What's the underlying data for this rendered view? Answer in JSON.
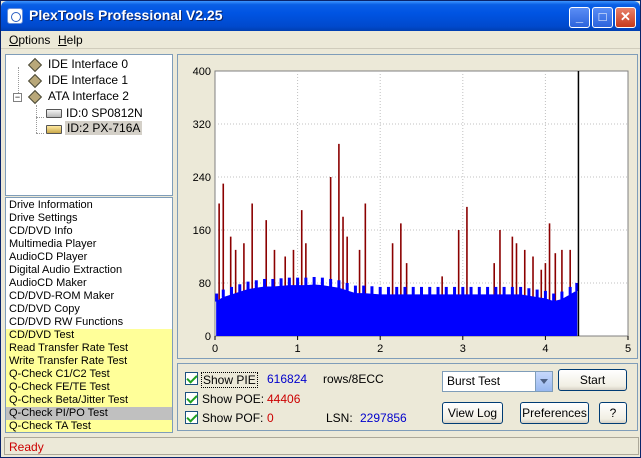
{
  "window": {
    "title": "PlexTools Professional V2.25",
    "minimize_glyph": "_",
    "maximize_glyph": "□",
    "close_glyph": "✕"
  },
  "menu": {
    "options_underline": "O",
    "options_rest": "ptions",
    "help_underline": "H",
    "help_rest": "elp"
  },
  "tree": {
    "ide0": "IDE Interface 0",
    "ide1": "IDE Interface 1",
    "ata2": "ATA Interface 2",
    "dev0": "ID:0  SP0812N",
    "dev2": "ID:2  PX-716A",
    "expander": "−"
  },
  "functions": [
    {
      "label": "Drive Information",
      "kind": "normal"
    },
    {
      "label": "Drive Settings",
      "kind": "normal"
    },
    {
      "label": "CD/DVD Info",
      "kind": "normal"
    },
    {
      "label": "Multimedia Player",
      "kind": "normal"
    },
    {
      "label": "AudioCD Player",
      "kind": "normal"
    },
    {
      "label": "Digital Audio Extraction",
      "kind": "normal"
    },
    {
      "label": "AudioCD Maker",
      "kind": "normal"
    },
    {
      "label": "CD/DVD-ROM Maker",
      "kind": "normal"
    },
    {
      "label": "CD/DVD Copy",
      "kind": "normal"
    },
    {
      "label": "CD/DVD RW Functions",
      "kind": "normal"
    },
    {
      "label": "CD/DVD Test",
      "kind": "test"
    },
    {
      "label": "Read Transfer Rate Test",
      "kind": "test"
    },
    {
      "label": "Write Transfer Rate Test",
      "kind": "test"
    },
    {
      "label": "Q-Check C1/C2 Test",
      "kind": "test"
    },
    {
      "label": "Q-Check FE/TE Test",
      "kind": "test"
    },
    {
      "label": "Q-Check Beta/Jitter Test",
      "kind": "test"
    },
    {
      "label": "Q-Check PI/PO Test",
      "kind": "selected"
    },
    {
      "label": "Q-Check TA Test",
      "kind": "test"
    }
  ],
  "controls": {
    "show_pie": "Show PIE",
    "pie_value": "616824",
    "pie_unit": "rows/8ECC",
    "show_poe": "Show POE:",
    "poe_value": "44406",
    "show_pof": "Show POF:",
    "pof_value": "0",
    "lsn_label": "LSN:",
    "lsn_value": "2297856",
    "test_mode": "Burst Test",
    "start": "Start",
    "view_log": "View Log",
    "preferences": "Preferences",
    "help": "?"
  },
  "status": {
    "text": "Ready"
  },
  "colors": {
    "pie": "#0000FF",
    "poe": "#8B0000",
    "plot_bg": "#FFFFFF",
    "grid": "#C0C0C0",
    "cursor": "#000000",
    "pie_value": "#0000CC",
    "poe_value": "#CC0000"
  },
  "chart_data": {
    "type": "bar",
    "x_ticks": [
      "0",
      "1",
      "2",
      "3",
      "4",
      "5"
    ],
    "y_ticks": [
      "0",
      "80",
      "160",
      "240",
      "320",
      "400"
    ],
    "xlim": [
      0,
      5
    ],
    "ylim": [
      0,
      400
    ],
    "cursor_x": 4.4,
    "data_end_x": 4.4,
    "grid": true,
    "series": [
      {
        "name": "PIE",
        "x": [
          0.02,
          0.1,
          0.2,
          0.3,
          0.4,
          0.5,
          0.6,
          0.7,
          0.8,
          0.9,
          1.0,
          1.1,
          1.2,
          1.3,
          1.4,
          1.5,
          1.6,
          1.7,
          1.8,
          1.9,
          2.0,
          2.1,
          2.2,
          2.3,
          2.4,
          2.5,
          2.6,
          2.7,
          2.8,
          2.9,
          3.0,
          3.1,
          3.2,
          3.3,
          3.4,
          3.5,
          3.6,
          3.7,
          3.8,
          3.9,
          4.0,
          4.1,
          4.2,
          4.3,
          4.38
        ],
        "values": [
          52,
          58,
          62,
          66,
          70,
          72,
          74,
          74,
          75,
          76,
          76,
          76,
          77,
          76,
          74,
          72,
          68,
          64,
          64,
          63,
          62,
          62,
          62,
          62,
          62,
          62,
          62,
          62,
          62,
          62,
          62,
          62,
          62,
          62,
          62,
          62,
          62,
          62,
          60,
          58,
          56,
          52,
          55,
          62,
          68
        ]
      },
      {
        "name": "POE",
        "x": [
          0.05,
          0.1,
          0.19,
          0.25,
          0.35,
          0.45,
          0.62,
          0.72,
          0.85,
          0.95,
          1.05,
          1.1,
          1.4,
          1.5,
          1.55,
          1.6,
          1.75,
          1.82,
          2.15,
          2.25,
          2.32,
          2.75,
          2.95,
          3.05,
          3.38,
          3.45,
          3.6,
          3.65,
          3.75,
          3.85,
          3.95,
          4.0,
          4.05,
          4.12,
          4.2,
          4.3
        ],
        "values": [
          200,
          230,
          150,
          130,
          140,
          200,
          175,
          130,
          120,
          130,
          190,
          140,
          240,
          290,
          180,
          150,
          130,
          200,
          140,
          170,
          110,
          90,
          160,
          195,
          110,
          160,
          150,
          140,
          130,
          120,
          100,
          110,
          170,
          125,
          130,
          130
        ]
      }
    ]
  }
}
